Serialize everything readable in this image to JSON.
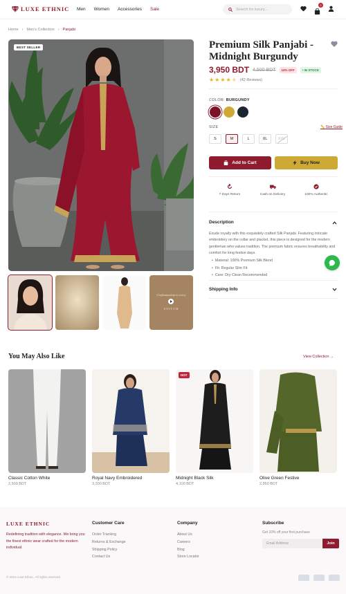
{
  "brand": {
    "name": "LUXE ETHNIC",
    "accent": "#8e1b2e",
    "gold": "#cfa935"
  },
  "nav": {
    "items": [
      "Men",
      "Women",
      "Accessories",
      "Sale"
    ]
  },
  "search": {
    "placeholder": "Search for luxury..."
  },
  "header": {
    "cart_count": "2",
    "icons": [
      "heart-icon",
      "bag-icon",
      "user-icon"
    ]
  },
  "breadcrumb": {
    "items": [
      "Home",
      "Men's Collection",
      "Panjabi"
    ]
  },
  "gallery": {
    "badge": "BEST SELLER",
    "thumb4_lines": [
      "Craftsmanship",
      "in every",
      "STITCH"
    ]
  },
  "product": {
    "title": "Premium Silk Panjabi - Midnight Burgundy",
    "price": "3,950 BDT",
    "old_price": "4,500 BDT",
    "discount": "10% OFF",
    "stock": "• IN STOCK",
    "rating": 4.5,
    "reviews": "(42 Reviews)",
    "color_label": "COLOR:",
    "color_value": "BURGUNDY",
    "colors": [
      "#7a1424",
      "#cfa935",
      "#1c2633"
    ],
    "size_label": "SIZE",
    "size_guide": "Size Guide",
    "sizes": [
      "S",
      "M",
      "L",
      "XL",
      "XXL"
    ],
    "selected_size": "M",
    "unavailable_size": "XXL",
    "add_to_cart": "Add to Cart",
    "buy_now": "Buy Now"
  },
  "features": [
    "7 Days Return",
    "Cash on Delivery",
    "100% Authentic"
  ],
  "description": {
    "heading": "Description",
    "text": "Exude royalty with this exquisitely crafted Silk Panjabi. Featuring intricate embroidery on the collar and placket, this piece is designed for the modern gentleman who values tradition. The premium fabric ensures breathability and comfort for long festive days.",
    "bullets": [
      "Material: 100% Premium Silk Blend",
      "Fit: Regular Slim Fit",
      "Care: Dry Clean Recommended"
    ]
  },
  "shipping": {
    "heading": "Shipping Info"
  },
  "related": {
    "heading": "You May Also Like",
    "view_all": "View Collection →",
    "items": [
      {
        "name": "Classic Cotton White",
        "price": "2,500 BDT"
      },
      {
        "name": "Royal Navy Embroidered",
        "price": "3,200 BDT"
      },
      {
        "name": "Midnight Black Silk",
        "price": "4,100 BDT",
        "badge": "HOT"
      },
      {
        "name": "Olive Green Festive",
        "price": "2,850 BDT"
      }
    ]
  },
  "footer": {
    "tagline": "Redefining tradition with elegance. We bring you the finest ethnic wear crafted for the modern individual.",
    "customer_care": {
      "heading": "Customer Care",
      "links": [
        "Order Tracking",
        "Returns & Exchange",
        "Shipping Policy",
        "Contact Us"
      ]
    },
    "company": {
      "heading": "Company",
      "links": [
        "About Us",
        "Careers",
        "Blog",
        "Store Locator"
      ]
    },
    "subscribe": {
      "heading": "Subscribe",
      "subtitle": "Get 10% off your first purchase",
      "placeholder": "Email Address",
      "button": "Join"
    },
    "copyright": "© 2024 Luxe Ethnic. All rights reserved."
  }
}
